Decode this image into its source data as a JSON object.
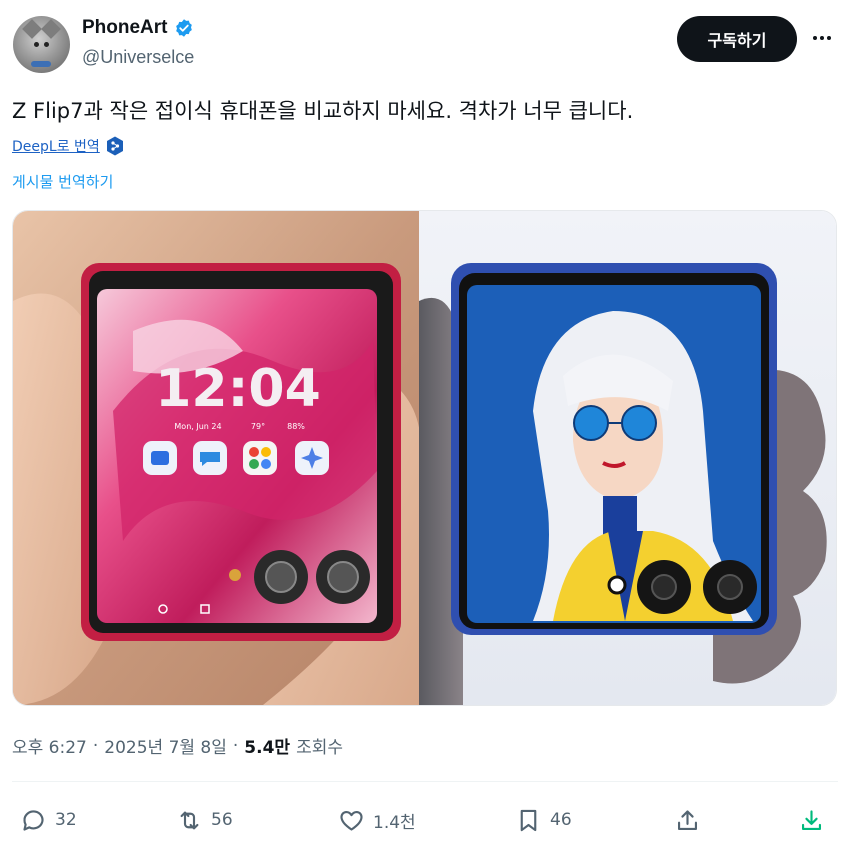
{
  "author": {
    "display_name": "PhoneArt",
    "handle": "@Universelce",
    "verified_color": "#1d9bf0"
  },
  "subscribe_label": "구독하기",
  "more_icon": "more-horizontal-icon",
  "tweet": {
    "text": "Z Flip7과 작은 접이식 휴대폰을 비교하지 마세요. 격차가 너무 큽니다.",
    "deepl_label": "DeepL로 번역",
    "translate_label": "게시물 번역하기"
  },
  "media": {
    "left_phone": {
      "time": "12:04",
      "date_line": "Mon, Jun 24",
      "weather": "79°",
      "battery": "88%"
    }
  },
  "meta": {
    "time": "오후 6:27",
    "dot1": "·",
    "date": "2025년 7월 8일",
    "dot2": "·",
    "views_count": "5.4만",
    "views_label": "조회수"
  },
  "actions": {
    "reply_count": "32",
    "repost_count": "56",
    "like_count": "1.4천",
    "bookmark_count": "46"
  },
  "colors": {
    "accent": "#1d9bf0",
    "download_green": "#00ba7c"
  }
}
